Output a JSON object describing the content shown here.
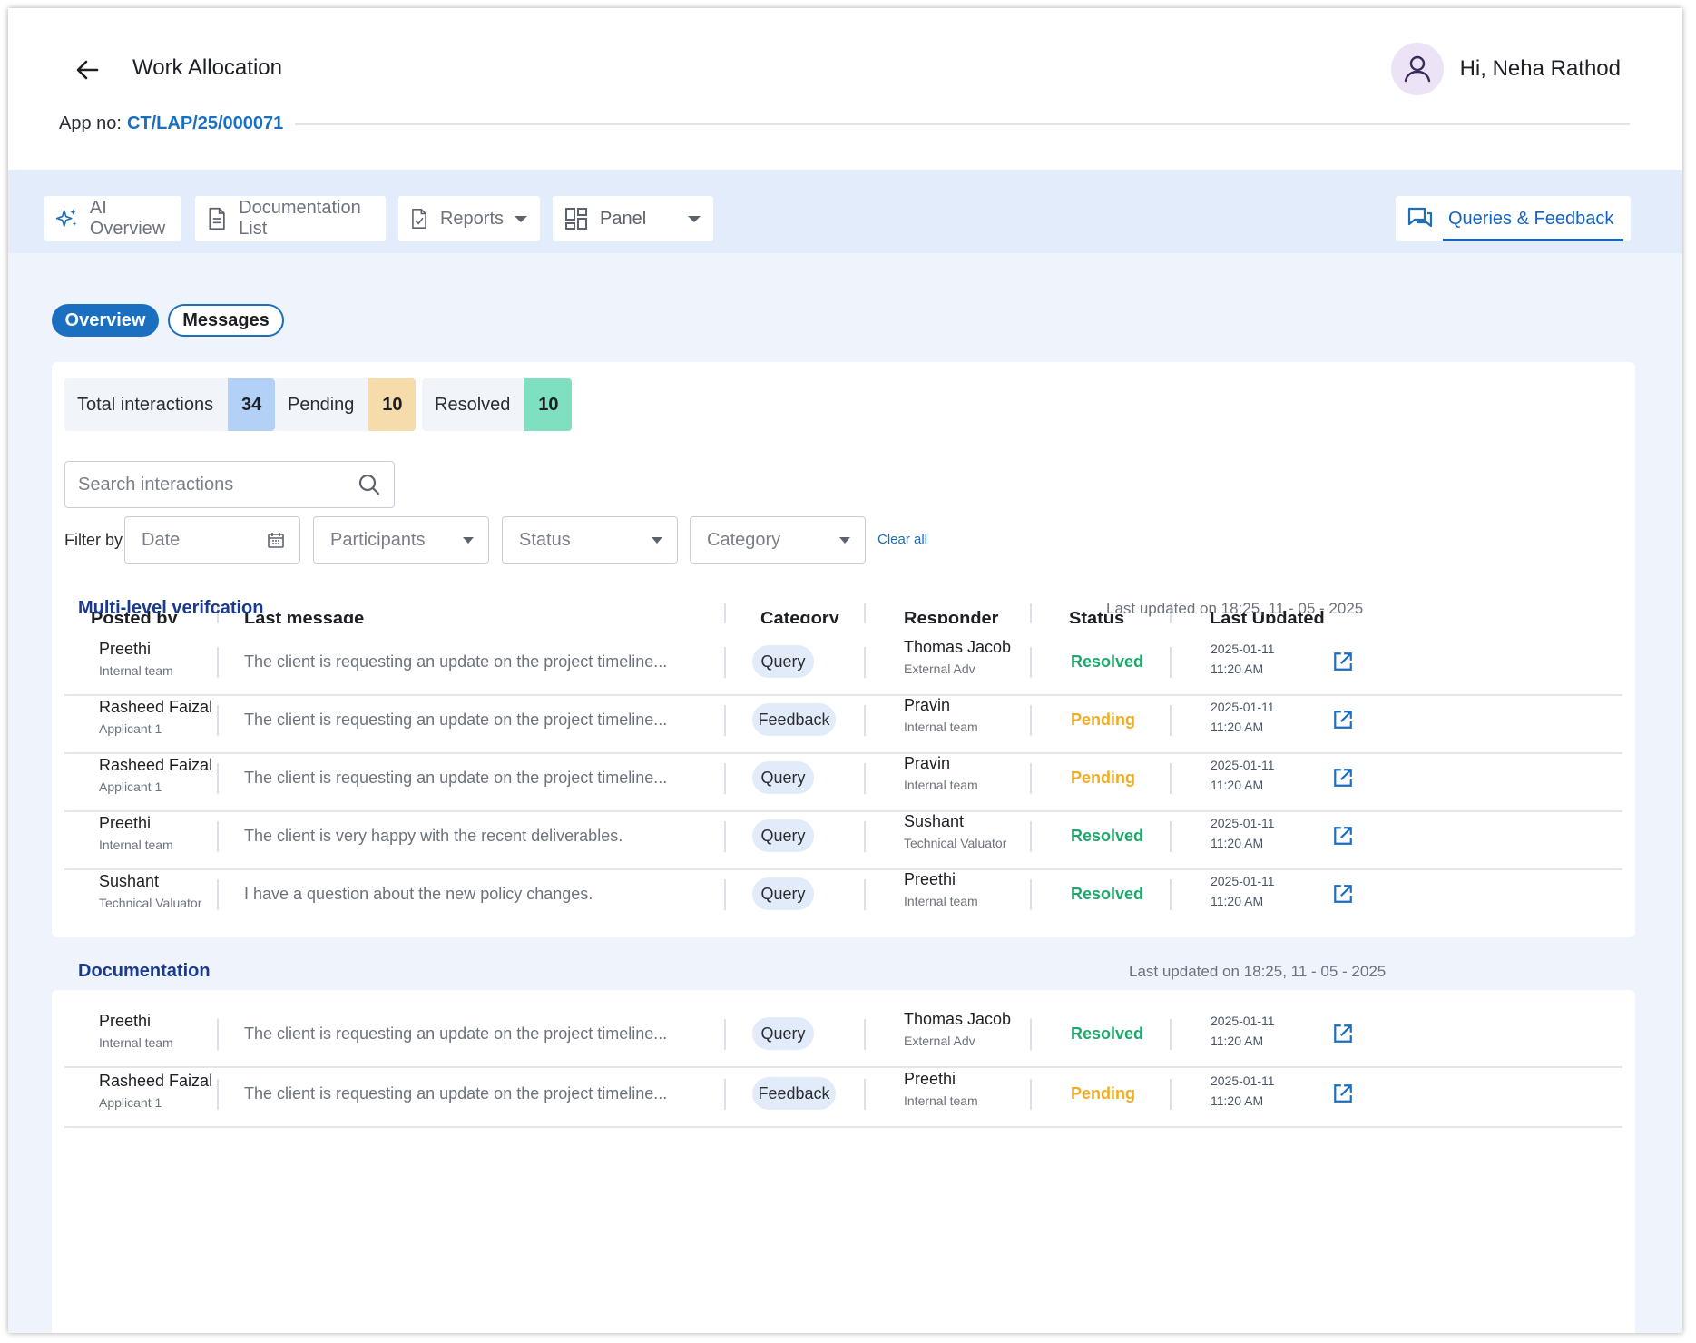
{
  "header": {
    "title": "Work Allocation",
    "greeting": "Hi, Neha Rathod",
    "app_no_label": "App no:",
    "app_no_value": "CT/LAP/25/000071"
  },
  "toolbar": {
    "ai_overview": "AI Overview",
    "documentation_list": "Documentation List",
    "reports": "Reports",
    "panel": "Panel",
    "queries_feedback": "Queries & Feedback"
  },
  "tabs": {
    "overview": "Overview",
    "messages": "Messages"
  },
  "stats": {
    "total_label": "Total interactions",
    "total_count": "34",
    "pending_label": "Pending",
    "pending_count": "10",
    "resolved_label": "Resolved",
    "resolved_count": "10"
  },
  "search": {
    "placeholder": "Search interactions"
  },
  "filters": {
    "label": "Filter by",
    "date": "Date",
    "participants": "Participants",
    "status": "Status",
    "category": "Category",
    "clear_all": "Clear all"
  },
  "columns": {
    "posted_by": "Posted by",
    "last_message": "Last message",
    "category": "Category",
    "responder": "Responder",
    "status": "Status",
    "last_updated": "Last Updated"
  },
  "colors": {
    "accent": "#1a6fc0",
    "resolved": "#1ea86a",
    "pending": "#f0ad20",
    "total_badge": "#b3d0f7",
    "pending_badge": "#f6dcaa",
    "resolved_badge": "#7fe0c1"
  },
  "groups": [
    {
      "title": "Multi-level verifcation",
      "updated": "Last updated on 18:25, 11 - 05 - 2025",
      "rows": [
        {
          "name": "Preethi",
          "role": "Internal team",
          "message": "The client is requesting an update on the project timeline...",
          "category": "Query",
          "responder": "Thomas Jacob",
          "responder_role": "External Adv",
          "status": "Resolved",
          "date": "2025-01-11",
          "time": "11:20 AM"
        },
        {
          "name": "Rasheed Faizal",
          "role": "Applicant 1",
          "message": "The client is requesting an update on the project timeline...",
          "category": "Feedback",
          "responder": "Pravin",
          "responder_role": "Internal team",
          "status": "Pending",
          "date": "2025-01-11",
          "time": "11:20 AM"
        },
        {
          "name": "Rasheed Faizal",
          "role": "Applicant 1",
          "message": "The client is requesting an update on the project timeline...",
          "category": "Query",
          "responder": "Pravin",
          "responder_role": "Internal team",
          "status": "Pending",
          "date": "2025-01-11",
          "time": "11:20 AM"
        },
        {
          "name": "Preethi",
          "role": "Internal team",
          "message": "The client is very happy with the recent deliverables.",
          "category": "Query",
          "responder": "Sushant",
          "responder_role": "Technical Valuator",
          "status": "Resolved",
          "date": "2025-01-11",
          "time": "11:20 AM"
        },
        {
          "name": "Sushant",
          "role": "Technical Valuator",
          "message": "I have a question about the new policy changes.",
          "category": "Query",
          "responder": "Preethi",
          "responder_role": "Internal team",
          "status": "Resolved",
          "date": "2025-01-11",
          "time": "11:20 AM"
        }
      ]
    },
    {
      "title": "Documentation",
      "updated": "Last updated on 18:25, 11 - 05 - 2025",
      "rows": [
        {
          "name": "Preethi",
          "role": "Internal team",
          "message": "The client is requesting an update on the project timeline...",
          "category": "Query",
          "responder": "Thomas Jacob",
          "responder_role": "External Adv",
          "status": "Resolved",
          "date": "2025-01-11",
          "time": "11:20 AM"
        },
        {
          "name": "Rasheed Faizal",
          "role": "Applicant 1",
          "message": "The client is requesting an update on the project timeline...",
          "category": "Feedback",
          "responder": "Preethi",
          "responder_role": "Internal team",
          "status": "Pending",
          "date": "2025-01-11",
          "time": "11:20 AM"
        }
      ]
    }
  ]
}
